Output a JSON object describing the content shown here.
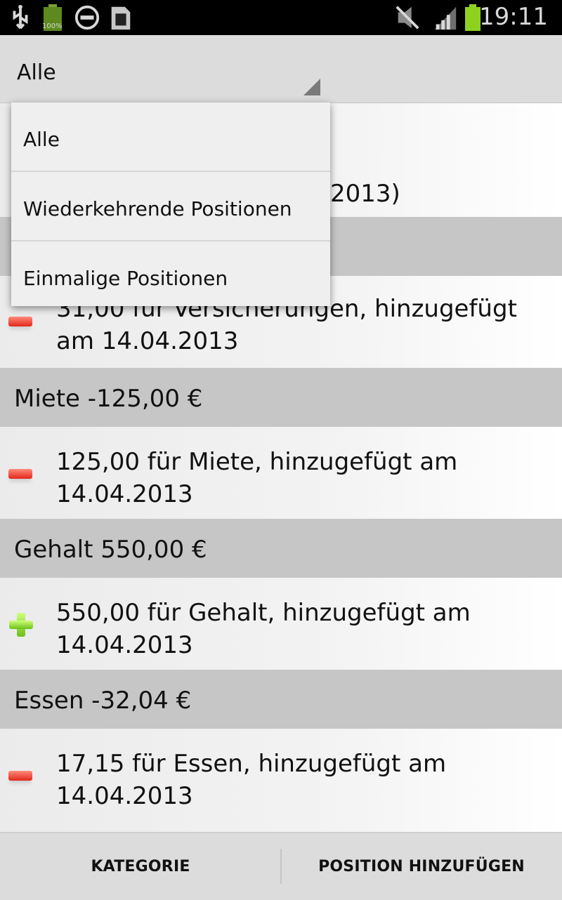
{
  "status_bar": {
    "time": "19:11",
    "battery_small_label": "100%",
    "icons": [
      "usb-icon",
      "battery-icon",
      "do-not-disturb-icon",
      "sd-card-icon",
      "mute-icon",
      "signal-icon",
      "battery-charging-icon"
    ],
    "colors": {
      "battery": "#8dd21e",
      "background": "#000000"
    }
  },
  "spinner": {
    "selected": "Alle"
  },
  "dropdown": {
    "options": [
      "Alle",
      "Wiederkehrende Positionen",
      "Einmalige Positionen"
    ]
  },
  "behind_text": "2013)",
  "list": {
    "partial_item": {
      "text": "31,00 für Versicherungen, hinzugefügt am 14.04.2013",
      "icon": "minus-icon"
    },
    "groups": [
      {
        "header": "Miete -125,00 €",
        "item": {
          "text": "125,00 für Miete, hinzugefügt am 14.04.2013",
          "icon": "minus-icon"
        }
      },
      {
        "header": "Gehalt 550,00 €",
        "item": {
          "text": "550,00 für Gehalt, hinzugefügt am 14.04.2013",
          "icon": "plus-icon"
        }
      },
      {
        "header": "Essen -32,04 €",
        "item": {
          "text": "17,15 für Essen, hinzugefügt am 14.04.2013",
          "icon": "minus-icon"
        }
      }
    ]
  },
  "bottom_bar": {
    "left_button": "KATEGORIE",
    "right_button": "POSITION HINZUFÜGEN"
  }
}
